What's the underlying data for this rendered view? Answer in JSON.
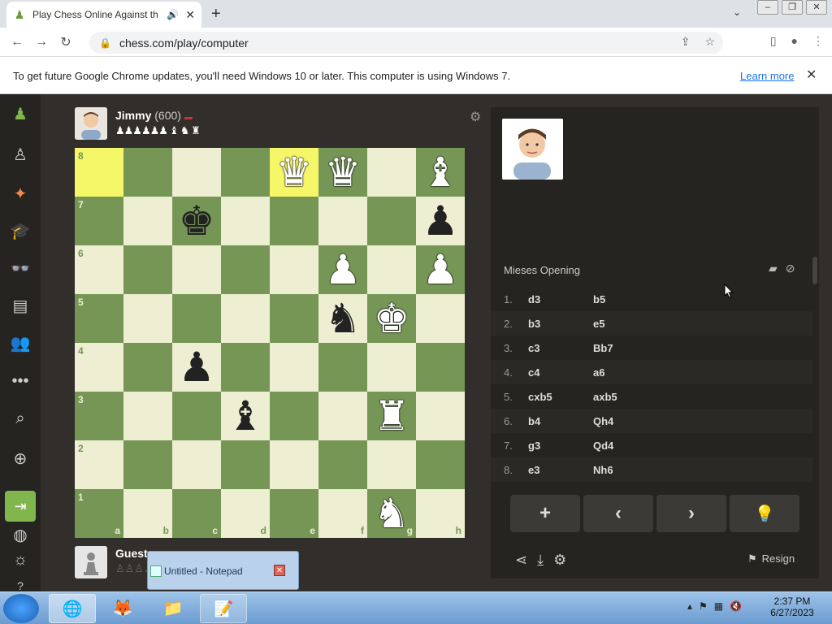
{
  "browser": {
    "tab_title": "Play Chess Online Against th",
    "url": "chess.com/play/computer",
    "infobar_message": "To get future Google Chrome updates, you'll need Windows 10 or later. This computer is using Windows 7.",
    "learn_more": "Learn more"
  },
  "game": {
    "top_player": {
      "name": "Jimmy",
      "rating": "(600)",
      "captured": "♟♟♟♟♟♟ ♝ ♞ ♜"
    },
    "bottom_player": {
      "name": "Guest",
      "captured": "♙♙♙♙♙"
    },
    "ranks": [
      "8",
      "7",
      "6",
      "5",
      "4",
      "3",
      "2",
      "1"
    ],
    "files": [
      "a",
      "b",
      "c",
      "d",
      "e",
      "f",
      "g",
      "h"
    ],
    "highlight_squares": [
      "a8",
      "e8"
    ],
    "pieces": [
      {
        "sq": "e8",
        "glyph": "♛",
        "color": "white"
      },
      {
        "sq": "f8",
        "glyph": "♛",
        "color": "white"
      },
      {
        "sq": "h8",
        "glyph": "♝",
        "color": "white"
      },
      {
        "sq": "c7",
        "glyph": "♚",
        "color": "black"
      },
      {
        "sq": "h7",
        "glyph": "♟",
        "color": "black"
      },
      {
        "sq": "f6",
        "glyph": "♟",
        "color": "white"
      },
      {
        "sq": "h6",
        "glyph": "♟",
        "color": "white"
      },
      {
        "sq": "f5",
        "glyph": "♞",
        "color": "black"
      },
      {
        "sq": "g5",
        "glyph": "♚",
        "color": "white"
      },
      {
        "sq": "c4",
        "glyph": "♟",
        "color": "black"
      },
      {
        "sq": "d3",
        "glyph": "♝",
        "color": "black"
      },
      {
        "sq": "g3",
        "glyph": "♜",
        "color": "white"
      },
      {
        "sq": "g1",
        "glyph": "♞",
        "color": "white"
      }
    ]
  },
  "panel": {
    "opening": "Mieses Opening",
    "moves": [
      {
        "n": "1.",
        "w": "d3",
        "b": "b5"
      },
      {
        "n": "2.",
        "w": "b3",
        "b": "e5"
      },
      {
        "n": "3.",
        "w": "c3",
        "b": "Bb7"
      },
      {
        "n": "4.",
        "w": "c4",
        "b": "a6"
      },
      {
        "n": "5.",
        "w": "cxb5",
        "b": "axb5"
      },
      {
        "n": "6.",
        "w": "b4",
        "b": "Qh4"
      },
      {
        "n": "7.",
        "w": "g3",
        "b": "Qd4"
      },
      {
        "n": "8.",
        "w": "e3",
        "b": "Nh6"
      }
    ],
    "buttons": [
      "+",
      "‹",
      "›",
      "💡"
    ],
    "resign": "Resign"
  },
  "notepad_preview": "Untitled - Notepad",
  "clock": {
    "time": "2:37 PM",
    "date": "6/27/2023"
  },
  "colors": {
    "board_light": "#eeeed2",
    "board_dark": "#769656",
    "highlight": "#f6f669",
    "accent": "#81b64c"
  }
}
